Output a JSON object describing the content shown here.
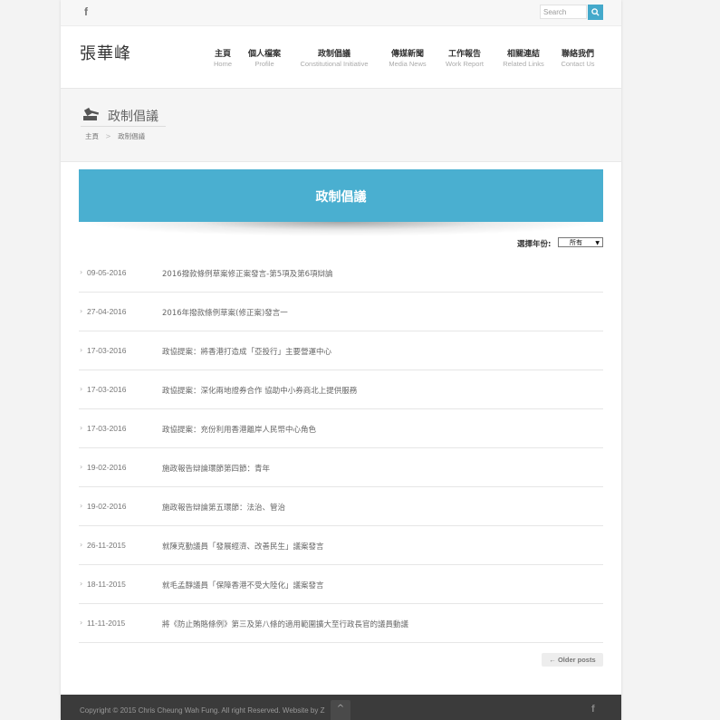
{
  "topbar": {
    "facebook_icon": "f",
    "search_placeholder": "Search"
  },
  "header": {
    "logo": "張華峰",
    "nav": [
      {
        "zh": "主頁",
        "en": "Home"
      },
      {
        "zh": "個人檔案",
        "en": "Profile"
      },
      {
        "zh": "政制倡議",
        "en": "Constitutional Initiative"
      },
      {
        "zh": "傳媒新聞",
        "en": "Media News"
      },
      {
        "zh": "工作報告",
        "en": "Work Report"
      },
      {
        "zh": "相關連結",
        "en": "Related Links"
      },
      {
        "zh": "聯絡我們",
        "en": "Contact Us"
      }
    ]
  },
  "page_title": {
    "title": "政制倡議",
    "breadcrumb": {
      "home": "主頁",
      "sep": ">",
      "current": "政制倡議"
    }
  },
  "banner": {
    "title": "政制倡議"
  },
  "filter": {
    "label": "選擇年份:",
    "selected": "所有"
  },
  "posts": [
    {
      "date": "09-05-2016",
      "title": "2016撥款條例草案修正案發言-第5項及第6項辯論"
    },
    {
      "date": "27-04-2016",
      "title": "2016年撥款條例草案(修正案)發言一"
    },
    {
      "date": "17-03-2016",
      "title": "政協提案：將香港打造成「亞投行」主要營運中心"
    },
    {
      "date": "17-03-2016",
      "title": "政協提案：深化兩地證券合作 協助中小券商北上提供服務"
    },
    {
      "date": "17-03-2016",
      "title": "政協提案：充份利用香港離岸人民幣中心角色"
    },
    {
      "date": "19-02-2016",
      "title": "施政報告辯論環節第四節：青年"
    },
    {
      "date": "19-02-2016",
      "title": "施政報告辯論第五環節：法治、管治"
    },
    {
      "date": "26-11-2015",
      "title": "就陳克勤議員「發展經濟、改善民生」議案發言"
    },
    {
      "date": "18-11-2015",
      "title": "就毛孟靜議員「保障香港不受大陸化」議案發言"
    },
    {
      "date": "11-11-2015",
      "title": "將《防止賄賂條例》第三及第八條的適用範圍擴大至行政長官的議員動議"
    }
  ],
  "pagination": {
    "older_label": "← Older posts"
  },
  "footer": {
    "copyright": "Copyright © 2015 Chris Cheung Wah Fung. All right Reserved. Website by Z",
    "facebook_icon": "f",
    "to_top_icon": "^"
  },
  "colors": {
    "accent": "#4aafd0",
    "footer": "#3b3b3b"
  }
}
